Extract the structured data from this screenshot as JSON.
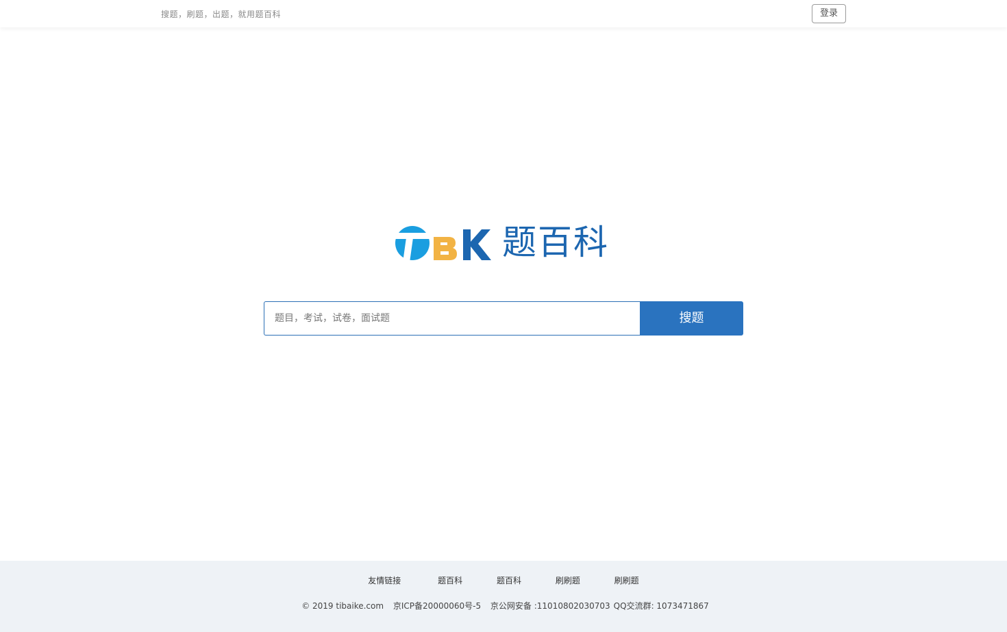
{
  "header": {
    "tagline": "搜题，刷题，出题，就用题百科",
    "login_label": "登录"
  },
  "logo": {
    "letters": [
      "T",
      "B",
      "K"
    ],
    "name": "题百科",
    "colors": {
      "t": "#1a9ee0",
      "b": "#f2b344",
      "k": "#1c66b0",
      "name": "#1c66b0"
    }
  },
  "search": {
    "placeholder": "题目，考试，试卷，面试题",
    "button_label": "搜题",
    "accent": "#2a73bf"
  },
  "footer": {
    "links_label": "友情链接",
    "links": [
      "题百科",
      "题百科",
      "刷刷题",
      "刷刷题"
    ],
    "copyright": "© 2019 tibaike.com",
    "icp": "京ICP备20000060号-5",
    "police": "京公网安备 :11010802030703",
    "qq": "QQ交流群: 1073471867"
  }
}
